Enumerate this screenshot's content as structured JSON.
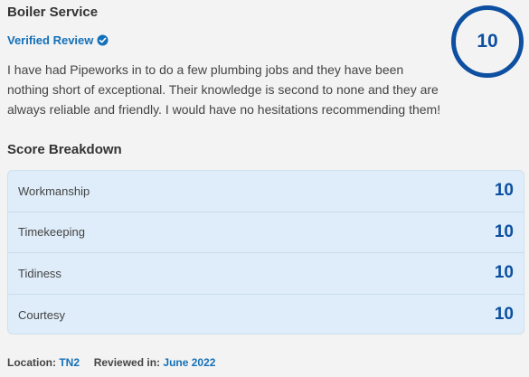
{
  "review": {
    "service": "Boiler Service",
    "verified_label": "Verified Review",
    "overall_score": "10",
    "text": "I have had Pipeworks in to do a few plumbing jobs and they have been nothing short of exceptional. Their knowledge is second to none and they are always reliable and friendly. I would have no hesitations recommending them!"
  },
  "breakdown": {
    "heading": "Score Breakdown",
    "rows": [
      {
        "label": "Workmanship",
        "score": "10"
      },
      {
        "label": "Timekeeping",
        "score": "10"
      },
      {
        "label": "Tidiness",
        "score": "10"
      },
      {
        "label": "Courtesy",
        "score": "10"
      }
    ]
  },
  "footer": {
    "location_label": "Location:",
    "location_value": "TN2",
    "reviewed_label": "Reviewed in:",
    "reviewed_value": "June 2022"
  },
  "colors": {
    "accent": "#0d4fa0",
    "link": "#1470b8",
    "panel": "#deedf9"
  },
  "icons": {
    "verified": "check-badge-icon"
  }
}
